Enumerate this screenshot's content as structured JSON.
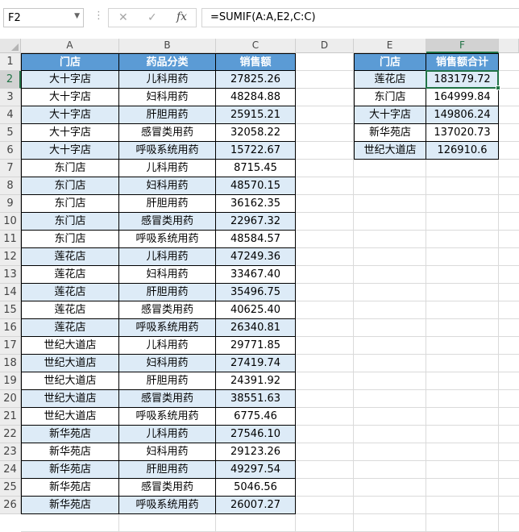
{
  "formula_bar": {
    "name_box": "F2",
    "cancel_icon": "✕",
    "enter_icon": "✓",
    "fx_label": "fx",
    "formula": "=SUMIF(A:A,E2,C:C)"
  },
  "columns": [
    "A",
    "B",
    "C",
    "D",
    "E",
    "F"
  ],
  "rows": [
    "1",
    "2",
    "3",
    "4",
    "5",
    "6",
    "7",
    "8",
    "9",
    "10",
    "11",
    "12",
    "13",
    "14",
    "15",
    "16",
    "17",
    "18",
    "19",
    "20",
    "21",
    "22",
    "23",
    "24",
    "25",
    "26"
  ],
  "table1": {
    "headers": [
      "门店",
      "药品分类",
      "销售额"
    ],
    "rows": [
      [
        "大十字店",
        "儿科用药",
        "27825.26"
      ],
      [
        "大十字店",
        "妇科用药",
        "48284.88"
      ],
      [
        "大十字店",
        "肝胆用药",
        "25915.21"
      ],
      [
        "大十字店",
        "感冒类用药",
        "32058.22"
      ],
      [
        "大十字店",
        "呼吸系统用药",
        "15722.67"
      ],
      [
        "东门店",
        "儿科用药",
        "8715.45"
      ],
      [
        "东门店",
        "妇科用药",
        "48570.15"
      ],
      [
        "东门店",
        "肝胆用药",
        "36162.35"
      ],
      [
        "东门店",
        "感冒类用药",
        "22967.32"
      ],
      [
        "东门店",
        "呼吸系统用药",
        "48584.57"
      ],
      [
        "莲花店",
        "儿科用药",
        "47249.36"
      ],
      [
        "莲花店",
        "妇科用药",
        "33467.40"
      ],
      [
        "莲花店",
        "肝胆用药",
        "35496.75"
      ],
      [
        "莲花店",
        "感冒类用药",
        "40625.40"
      ],
      [
        "莲花店",
        "呼吸系统用药",
        "26340.81"
      ],
      [
        "世纪大道店",
        "儿科用药",
        "29771.85"
      ],
      [
        "世纪大道店",
        "妇科用药",
        "27419.74"
      ],
      [
        "世纪大道店",
        "肝胆用药",
        "24391.92"
      ],
      [
        "世纪大道店",
        "感冒类用药",
        "38551.63"
      ],
      [
        "世纪大道店",
        "呼吸系统用药",
        "6775.46"
      ],
      [
        "新华苑店",
        "儿科用药",
        "27546.10"
      ],
      [
        "新华苑店",
        "妇科用药",
        "29123.26"
      ],
      [
        "新华苑店",
        "肝胆用药",
        "49297.54"
      ],
      [
        "新华苑店",
        "感冒类用药",
        "5046.56"
      ],
      [
        "新华苑店",
        "呼吸系统用药",
        "26007.27"
      ]
    ]
  },
  "table2": {
    "headers": [
      "门店",
      "销售额合计"
    ],
    "rows": [
      [
        "莲花店",
        "183179.72"
      ],
      [
        "东门店",
        "164999.84"
      ],
      [
        "大十字店",
        "149806.24"
      ],
      [
        "新华苑店",
        "137020.73"
      ],
      [
        "世纪大道店",
        "126910.6"
      ]
    ]
  },
  "colors": {
    "header_fill": "#5b9bd5",
    "band_fill": "#ddebf7",
    "selection": "#217346"
  },
  "selected_cell": "F2"
}
